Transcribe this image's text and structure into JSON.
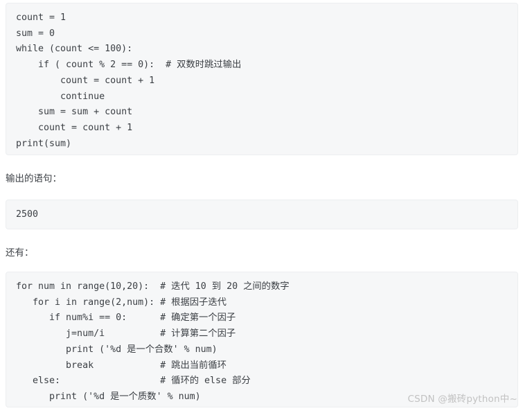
{
  "document": {
    "title": "Python while / for loop code examples",
    "background_color": "#ffffff",
    "text_color": "#3b3f44",
    "code_background_color": "#f6f7f8",
    "code_border_color": "#eceef0",
    "watermark_color": "#c2c2c2"
  },
  "code_block_1": {
    "language": "python",
    "lines": [
      "count = 1",
      "sum = 0",
      "while (count <= 100):",
      "    if ( count % 2 == 0):  # 双数时跳过输出",
      "        count = count + 1",
      "        continue",
      "    sum = sum + count",
      "    count = count + 1",
      "print(sum)"
    ],
    "text": "count = 1\nsum = 0\nwhile (count <= 100):\n    if ( count % 2 == 0):  # 双数时跳过输出\n        count = count + 1\n        continue\n    sum = sum + count\n    count = count + 1\nprint(sum)"
  },
  "label_output": "输出的语句：",
  "code_block_2": {
    "language": "text",
    "lines": [
      "2500"
    ],
    "text": "2500"
  },
  "label_more": "还有：",
  "code_block_3": {
    "language": "python",
    "lines": [
      "for num in range(10,20):  # 迭代 10 到 20 之间的数字",
      "   for i in range(2,num): # 根据因子迭代",
      "      if num%i == 0:      # 确定第一个因子",
      "         j=num/i          # 计算第二个因子",
      "         print ('%d 是一个合数' % num)",
      "         break            # 跳出当前循环",
      "   else:                  # 循环的 else 部分",
      "      print ('%d 是一个质数' % num)"
    ],
    "text": "for num in range(10,20):  # 迭代 10 到 20 之间的数字\n   for i in range(2,num): # 根据因子迭代\n      if num%i == 0:      # 确定第一个因子\n         j=num/i          # 计算第二个因子\n         print ('%d 是一个合数' % num)\n         break            # 跳出当前循环\n   else:                  # 循环的 else 部分\n      print ('%d 是一个质数' % num)"
  },
  "watermark": "CSDN @搬砖python中~"
}
